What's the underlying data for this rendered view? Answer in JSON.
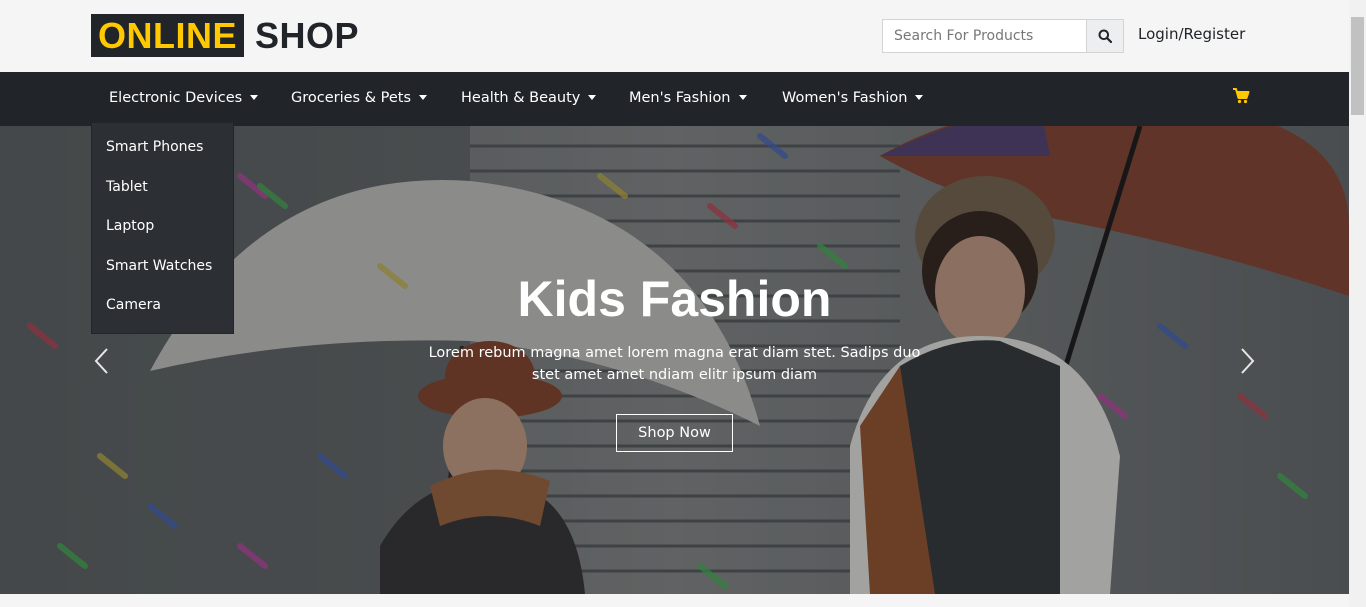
{
  "logo": {
    "highlight": "ONLINE",
    "rest": "SHOP",
    "highlight_color": "#ffc800"
  },
  "search": {
    "placeholder": "Search For Products",
    "icon": "search-icon"
  },
  "login_label": "Login/Register",
  "nav": {
    "items": [
      {
        "label": "Electronic Devices"
      },
      {
        "label": "Groceries & Pets"
      },
      {
        "label": "Health & Beauty"
      },
      {
        "label": "Men's Fashion"
      },
      {
        "label": "Women's Fashion"
      }
    ],
    "cart_icon": "shopping-cart-icon"
  },
  "dropdown": {
    "items": [
      "Smart Phones",
      "Tablet",
      "Laptop",
      "Smart Watches",
      "Camera"
    ]
  },
  "hero": {
    "title": "Kids Fashion",
    "subtitle": "Lorem rebum magna amet lorem magna erat diam stet. Sadips duo stet amet amet ndiam elitr ipsum diam",
    "button": "Shop Now",
    "prev_icon": "chevron-left-icon",
    "next_icon": "chevron-right-icon"
  },
  "colors": {
    "dark": "#212529",
    "accent": "#ffc800"
  }
}
